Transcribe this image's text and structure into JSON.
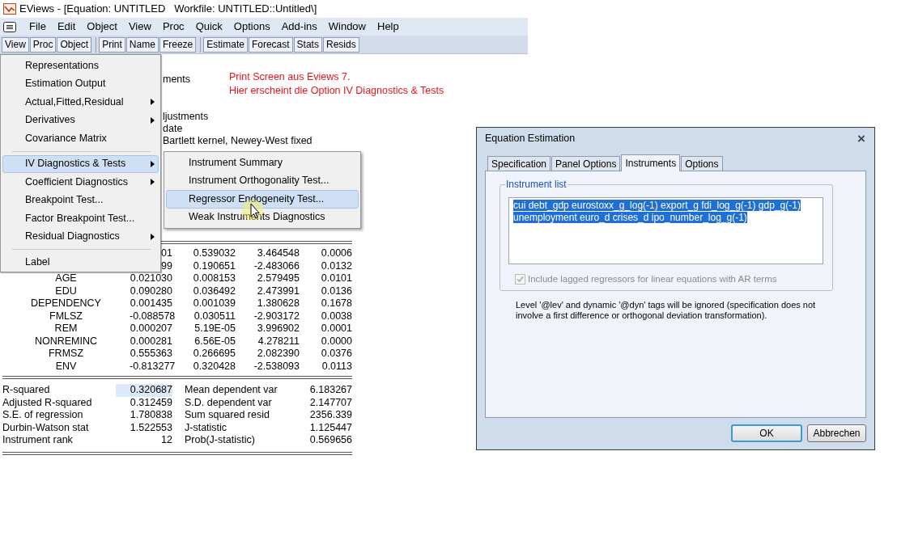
{
  "window": {
    "title": "EViews - [Equation: UNTITLED   Workfile: UNTITLED::Untitled\\]"
  },
  "menu_bar": [
    "File",
    "Edit",
    "Object",
    "View",
    "Proc",
    "Quick",
    "Options",
    "Add-ins",
    "Window",
    "Help"
  ],
  "toolbar_groups": [
    [
      "View",
      "Proc",
      "Object"
    ],
    [
      "Print",
      "Name",
      "Freeze"
    ],
    [
      "Estimate",
      "Forecast",
      "Stats",
      "Resids"
    ]
  ],
  "output": {
    "partial_lines": [
      "ments",
      "ljustments",
      "date",
      "Bartlett kernel, Newey-West fixed"
    ],
    "rows": [
      {
        "coefficient": "01",
        "std_error": "0.539032",
        "t_statistic": "3.464548",
        "prob": "0.0006"
      },
      {
        "coefficient": "99",
        "std_error": "0.190651",
        "t_statistic": "-2.483066",
        "prob": "0.0132"
      },
      {
        "variable": "AGE",
        "coefficient": "0.021030",
        "std_error": "0.008153",
        "t_statistic": "2.579495",
        "prob": "0.0101"
      },
      {
        "variable": "EDU",
        "coefficient": "0.090280",
        "std_error": "0.036492",
        "t_statistic": "2.473991",
        "prob": "0.0136"
      },
      {
        "variable": "DEPENDENCY",
        "coefficient": "0.001435",
        "std_error": "0.001039",
        "t_statistic": "1.380628",
        "prob": "0.1678"
      },
      {
        "variable": "FMLSZ",
        "coefficient": "-0.088578",
        "std_error": "0.030511",
        "t_statistic": "-2.903172",
        "prob": "0.0038"
      },
      {
        "variable": "REM",
        "coefficient": "0.000207",
        "std_error": "5.19E-05",
        "t_statistic": "3.996902",
        "prob": "0.0001"
      },
      {
        "variable": "NONREMINC",
        "coefficient": "0.000281",
        "std_error": "6.56E-05",
        "t_statistic": "4.278211",
        "prob": "0.0000"
      },
      {
        "variable": "FRMSZ",
        "coefficient": "0.555363",
        "std_error": "0.266695",
        "t_statistic": "2.082390",
        "prob": "0.0376"
      },
      {
        "variable": "ENV",
        "coefficient": "-0.813277",
        "std_error": "0.320428",
        "t_statistic": "-2.538093",
        "prob": "0.0113"
      }
    ],
    "statistics": [
      {
        "label": "R-squared",
        "value": "0.320687",
        "selected": true,
        "label_2": "Mean dependent var",
        "value_2": "6.183267"
      },
      {
        "label": "Adjusted R-squared",
        "value": "0.312459",
        "selected": false,
        "label_2": "S.D. dependent var",
        "value_2": "2.147707"
      },
      {
        "label": "S.E. of regression",
        "value": "1.780838",
        "selected": false,
        "label_2": "Sum squared resid",
        "value_2": "2356.339"
      },
      {
        "label": "Durbin-Watson stat",
        "value": "1.522553",
        "selected": false,
        "label_2": "J-statistic",
        "value_2": "1.125447"
      },
      {
        "label": "Instrument rank",
        "value": "12",
        "selected": false,
        "label_2": "Prob(J-statistic)",
        "value_2": "0.569656"
      }
    ]
  },
  "view_menu": [
    {
      "kind": "item",
      "label": "Representations",
      "submenu": false,
      "selected": false
    },
    {
      "kind": "item",
      "label": "Estimation Output",
      "submenu": false,
      "selected": false
    },
    {
      "kind": "item",
      "label": "Actual,Fitted,Residual",
      "submenu": true,
      "selected": false
    },
    {
      "kind": "item",
      "label": "Derivatives",
      "submenu": true,
      "selected": false
    },
    {
      "kind": "item",
      "label": "Covariance Matrix",
      "submenu": false,
      "selected": false
    },
    {
      "kind": "separator"
    },
    {
      "kind": "item",
      "label": "IV Diagnostics & Tests",
      "submenu": true,
      "selected": true
    },
    {
      "kind": "item",
      "label": "Coefficient Diagnostics",
      "submenu": true,
      "selected": false
    },
    {
      "kind": "item",
      "label": "Breakpoint Test...",
      "submenu": false,
      "selected": false
    },
    {
      "kind": "item",
      "label": "Factor Breakpoint Test...",
      "submenu": false,
      "selected": false
    },
    {
      "kind": "item",
      "label": "Residual Diagnostics",
      "submenu": true,
      "selected": false
    },
    {
      "kind": "separator"
    },
    {
      "kind": "item",
      "label": "Label",
      "submenu": false,
      "selected": false
    }
  ],
  "iv_submenu": [
    {
      "label": "Instrument Summary",
      "selected": false
    },
    {
      "label": "Instrument Orthogonality Test...",
      "selected": false
    },
    {
      "label": "Regressor Endogeneity Test...",
      "selected": true
    },
    {
      "label": "Weak Instruments Diagnostics",
      "selected": false
    }
  ],
  "annotation": [
    "Print Screen aus Eviews 7.",
    "Hier erscheint die Option IV Diagnostics & Tests"
  ],
  "dialog": {
    "title": "Equation Estimation",
    "close": "×",
    "tabs": [
      {
        "label": "Specification",
        "selected": false
      },
      {
        "label": "Panel Options",
        "selected": false
      },
      {
        "label": "Instruments",
        "selected": true
      },
      {
        "label": "Options",
        "selected": false
      }
    ],
    "group_label": "Instrument list",
    "instrument_list": {
      "lines": [
        "cui debt_gdp eurostoxx_g_log(-1) export_g fdi_log_g(-1) gdp_g(-1)",
        "unemployment euro_d crises_d ipo_number_log_g(-1)"
      ],
      "text_selected": true
    },
    "checkbox": {
      "label": "Include lagged regressors for linear equations with AR terms",
      "checked": true,
      "disabled": true
    },
    "note": "Level '@lev' and dynamic '@dyn' tags will be ignored (specification does not involve a first difference or orthogonal deviation transformation).",
    "buttons": [
      {
        "label": "OK",
        "default": true
      },
      {
        "label": "Abbrechen",
        "default": false
      }
    ]
  }
}
